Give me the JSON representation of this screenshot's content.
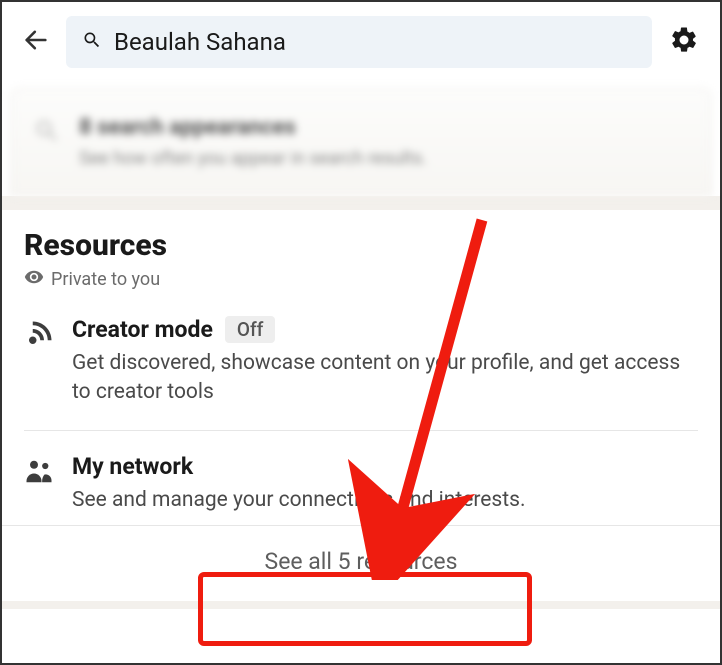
{
  "header": {
    "search_value": "Beaulah Sahana"
  },
  "promo": {
    "title": "8 search appearances",
    "subtitle": "See how often you appear in search results."
  },
  "resources": {
    "section_title": "Resources",
    "privacy_label": "Private to you",
    "items": [
      {
        "title": "Creator mode",
        "badge": "Off",
        "description": "Get discovered, showcase content on your profile, and get access to creator tools"
      },
      {
        "title": "My network",
        "badge": null,
        "description": "See and manage your connections and interests."
      }
    ],
    "see_all_label": "See all 5 resources"
  }
}
